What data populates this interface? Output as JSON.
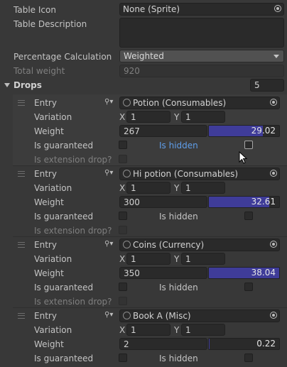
{
  "table_icon": {
    "label": "Table Icon",
    "value": "None (Sprite)"
  },
  "table_description": {
    "label": "Table Description",
    "value": ""
  },
  "percentage_calculation": {
    "label": "Percentage Calculation",
    "value": "Weighted"
  },
  "total_weight": {
    "label": "Total weight",
    "value": "920"
  },
  "drops": {
    "label": "Drops",
    "count": "5",
    "field_labels": {
      "entry": "Entry",
      "variation": "Variation",
      "weight": "Weight",
      "is_guaranteed": "Is guaranteed",
      "is_hidden": "Is hidden",
      "is_extension_drop": "Is extension drop?",
      "x": "X",
      "y": "Y"
    },
    "items": [
      {
        "entry": "Potion (Consumables)",
        "x": "1",
        "y": "1",
        "weight": "267",
        "percent": "29.02",
        "percent_fraction": 0.2902
      },
      {
        "entry": "Hi potion (Consumables)",
        "x": "1",
        "y": "1",
        "weight": "300",
        "percent": "32.61",
        "percent_fraction": 0.3261
      },
      {
        "entry": "Coins (Currency)",
        "x": "1",
        "y": "1",
        "weight": "350",
        "percent": "38.04",
        "percent_fraction": 0.3804
      },
      {
        "entry": "Book A (Misc)",
        "x": "1",
        "y": "1",
        "weight": "2",
        "percent": "0.22",
        "percent_fraction": 0.0022
      }
    ]
  },
  "colors": {
    "percent_bar": "#3f3c99",
    "background": "#383838"
  }
}
